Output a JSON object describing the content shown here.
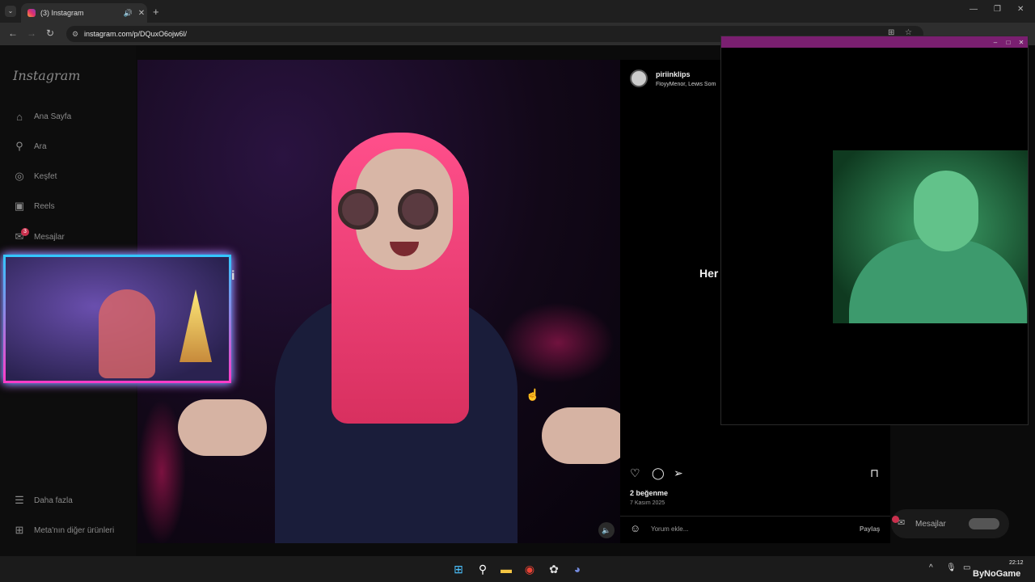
{
  "browser": {
    "tab_title": "(3) Instagram",
    "url": "instagram.com/p/DQuxO6ojw6l/",
    "new_tab": "+",
    "tab_close": "✕",
    "minimize": "—",
    "restore": "❐",
    "close": "✕"
  },
  "instagram": {
    "logo": "Instagram",
    "nav": [
      {
        "label": "Ana Sayfa",
        "icon": "home-icon"
      },
      {
        "label": "Ara",
        "icon": "search-icon"
      },
      {
        "label": "Keşfet",
        "icon": "compass-icon"
      },
      {
        "label": "Reels",
        "icon": "reels-icon"
      },
      {
        "label": "Mesajlar",
        "icon": "messenger-icon"
      }
    ],
    "messages_badge": "3",
    "bottom_nav": [
      {
        "label": "Daha fazla",
        "icon": "menu-icon"
      },
      {
        "label": "Meta'nın diğer ürünleri",
        "icon": "meta-icon"
      }
    ],
    "post": {
      "username": "piriinklips",
      "music": "FloyyMenor, Lewis Som",
      "overlay_text": "Her",
      "likes": "2 beğenme",
      "date": "7 Kasım 2025",
      "comment_placeholder": "Yorum ekle...",
      "share": "Paylaş"
    },
    "messages_bar": {
      "label": "Mesajlar",
      "badge": "1"
    }
  },
  "overlay_fragment": "i",
  "taskbar": {
    "time": "22:12",
    "watermark": "ByNoGame"
  },
  "colors": {
    "accent": "#e1306c",
    "webcam_border": "#33c7ff",
    "badge": "#c9304d",
    "titlebar": "#7a1f70"
  }
}
